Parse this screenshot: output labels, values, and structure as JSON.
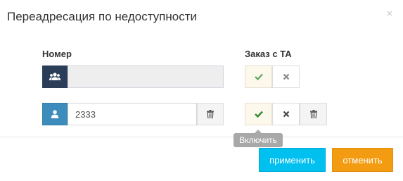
{
  "dialog": {
    "title": "Переадресация по недоступности",
    "close_glyph": "×"
  },
  "columns": {
    "number_label": "Номер",
    "order_label": "Заказ с ТА"
  },
  "rows": [
    {
      "icon": "group-icon",
      "value": "",
      "disabled": true,
      "order_on": true,
      "has_delete": false
    },
    {
      "icon": "user-icon",
      "value": "2333",
      "disabled": false,
      "order_on": true,
      "has_delete": true
    }
  ],
  "tooltip": {
    "text": "Включить"
  },
  "footer": {
    "apply_label": "применить",
    "cancel_label": "отменить"
  },
  "colors": {
    "primary_dark": "#2b3e57",
    "primary": "#3c8dbc",
    "info": "#00c0ef",
    "warning": "#f39c12",
    "check_green": "#3c9a3c"
  }
}
